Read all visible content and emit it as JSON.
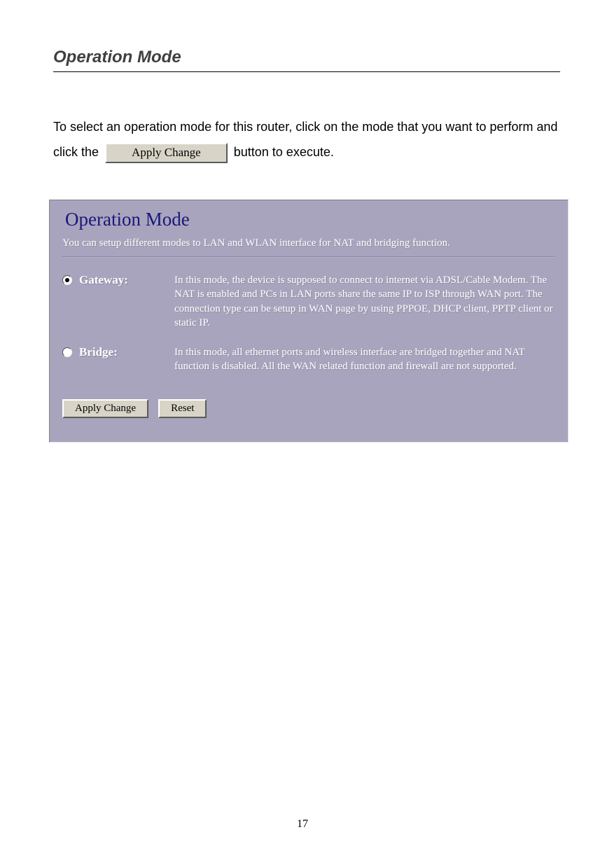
{
  "page": {
    "heading": "Operation Mode",
    "intro_part1": "To select an operation mode for this router, click on the mode that you want to perform and click the",
    "intro_button": "Apply Change",
    "intro_part2": "button to execute.",
    "number": "17"
  },
  "screenshot": {
    "title": "Operation Mode",
    "subtitle": "You can setup different modes to LAN and WLAN interface for NAT and bridging function.",
    "modes": [
      {
        "label": "Gateway:",
        "selected": true,
        "description": "In this mode, the device is supposed to connect to internet via ADSL/Cable Modem. The NAT is enabled and PCs in LAN ports share the same IP to ISP through WAN port. The connection type can be setup in WAN page by using PPPOE, DHCP client, PPTP client or static IP."
      },
      {
        "label": "Bridge:",
        "selected": false,
        "description": "In this mode, all ethernet ports and wireless interface are bridged together and NAT function is disabled. All the WAN related function and firewall are not supported."
      }
    ],
    "buttons": {
      "apply": "Apply Change",
      "reset": "Reset"
    }
  }
}
